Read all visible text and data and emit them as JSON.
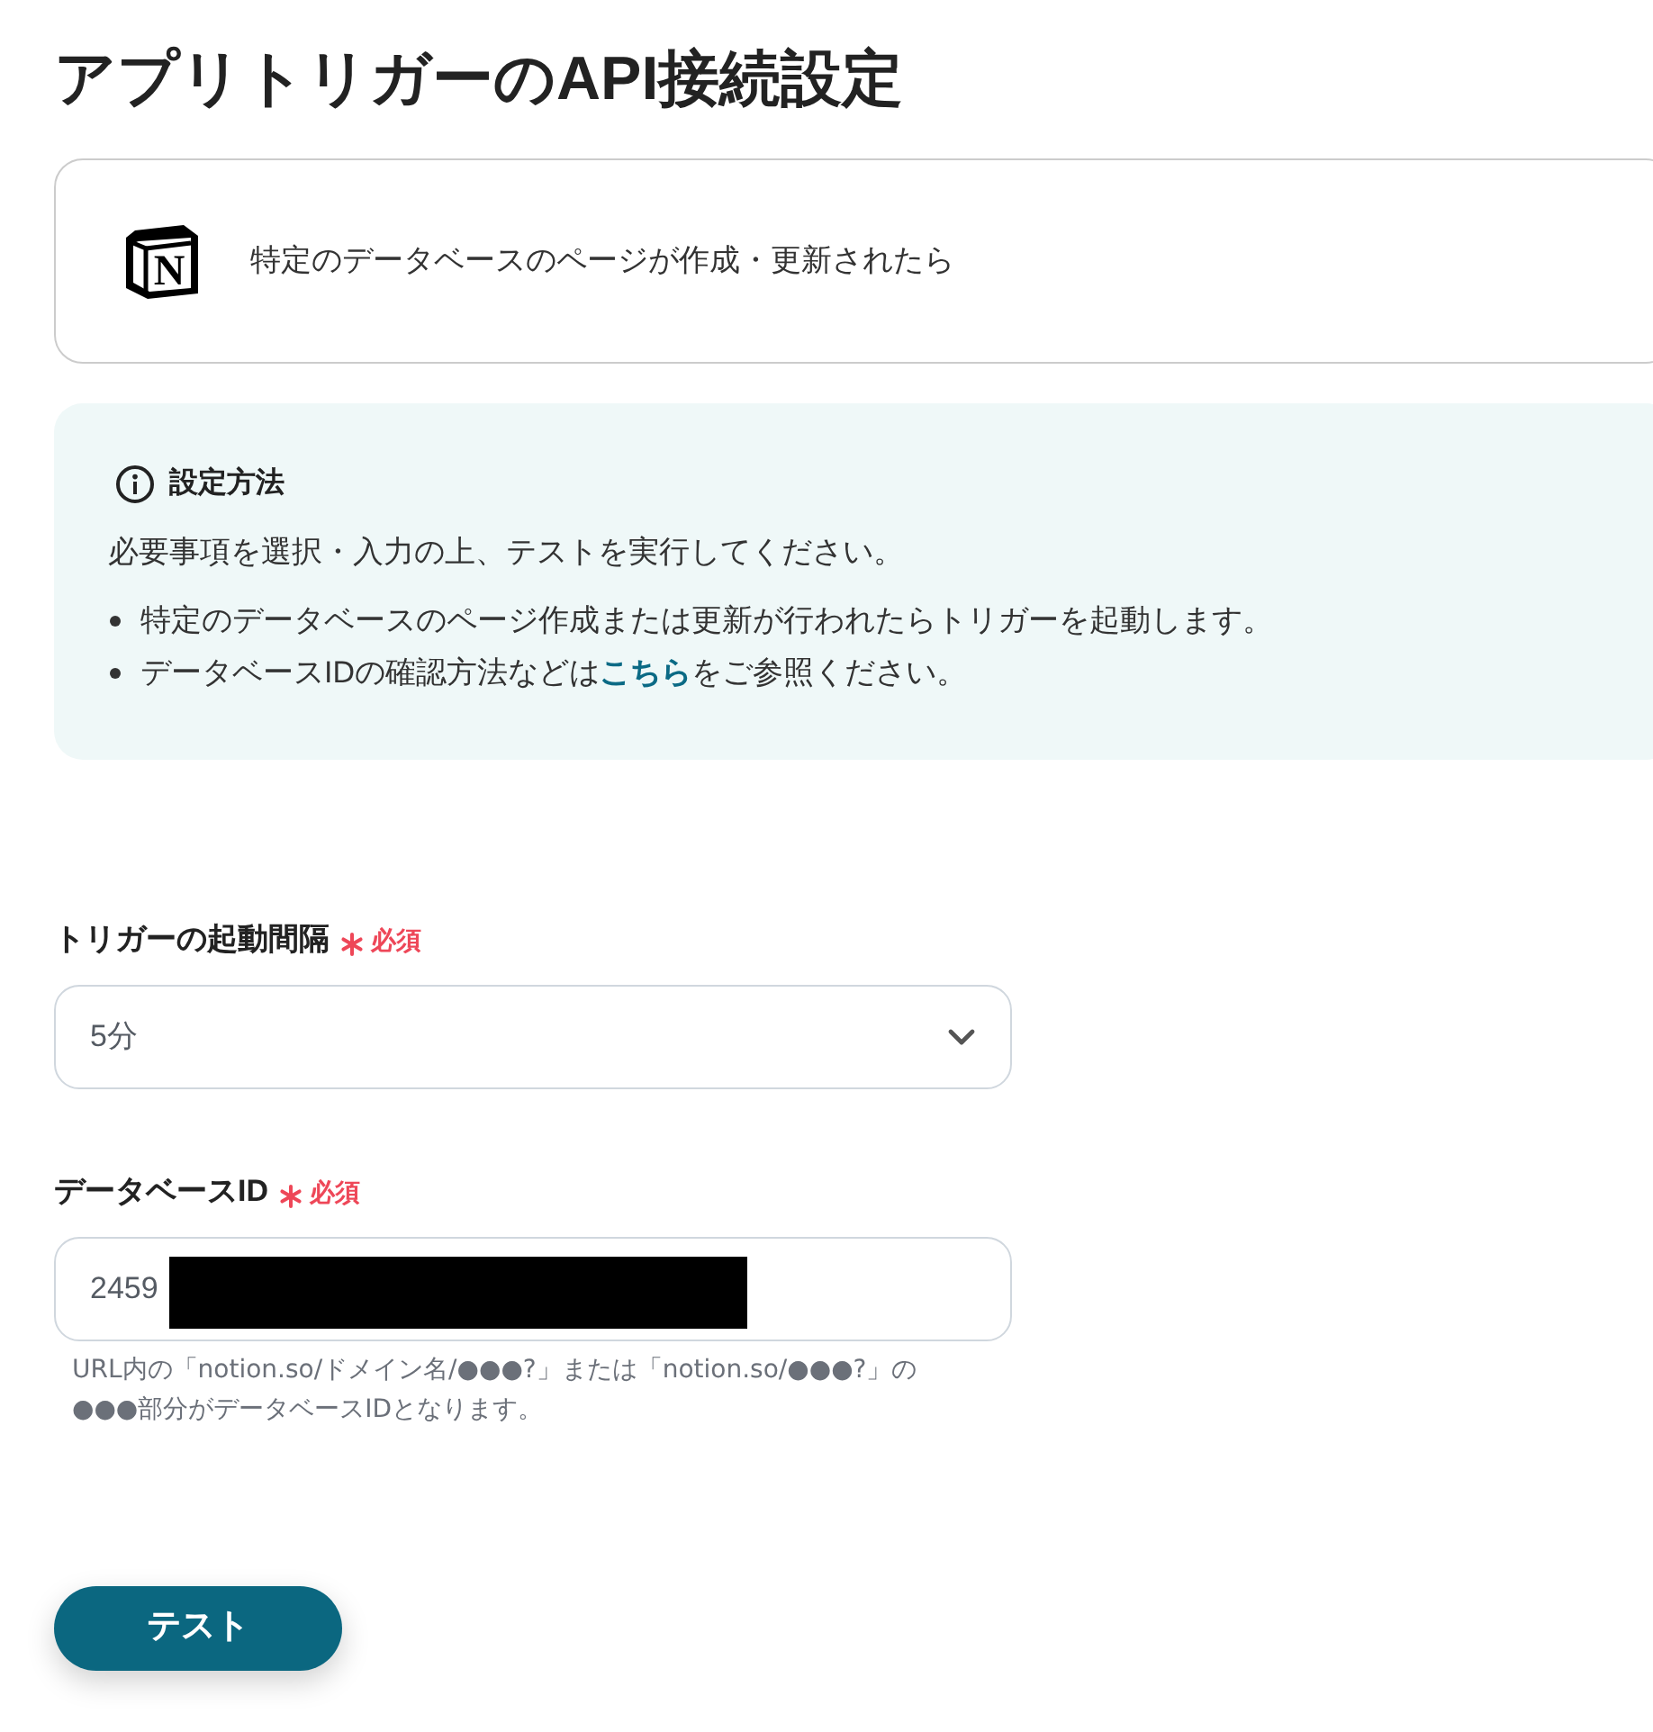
{
  "page": {
    "title": "アプリトリガーのAPI接続設定"
  },
  "trigger_card": {
    "app_logo": "N",
    "text": "特定のデータベースのページが作成・更新されたら"
  },
  "instructions": {
    "heading": "設定方法",
    "intro": "必要事項を選択・入力の上、テストを実行してください。",
    "bullets": [
      {
        "text": "特定のデータベースのページ作成または更新が行われたらトリガーを起動します。"
      },
      {
        "text": "データベースIDの確認方法などは",
        "link": "こちら",
        "text_after": "をご参照ください。"
      }
    ]
  },
  "fields": [
    {
      "kind": "select",
      "label": "トリガーの起動間隔",
      "required": true,
      "required_label": "必須",
      "value": "5分"
    },
    {
      "kind": "text",
      "label": "データベースID",
      "required": true,
      "required_label": "必須",
      "value": "2459",
      "redacted": true,
      "help": "URL内の「notion.so/ドメイン名/●●●?」または「notion.so/●●●?」の●●●部分がデータベースIDとなります。"
    }
  ],
  "test_button": {
    "label": "テスト"
  }
}
